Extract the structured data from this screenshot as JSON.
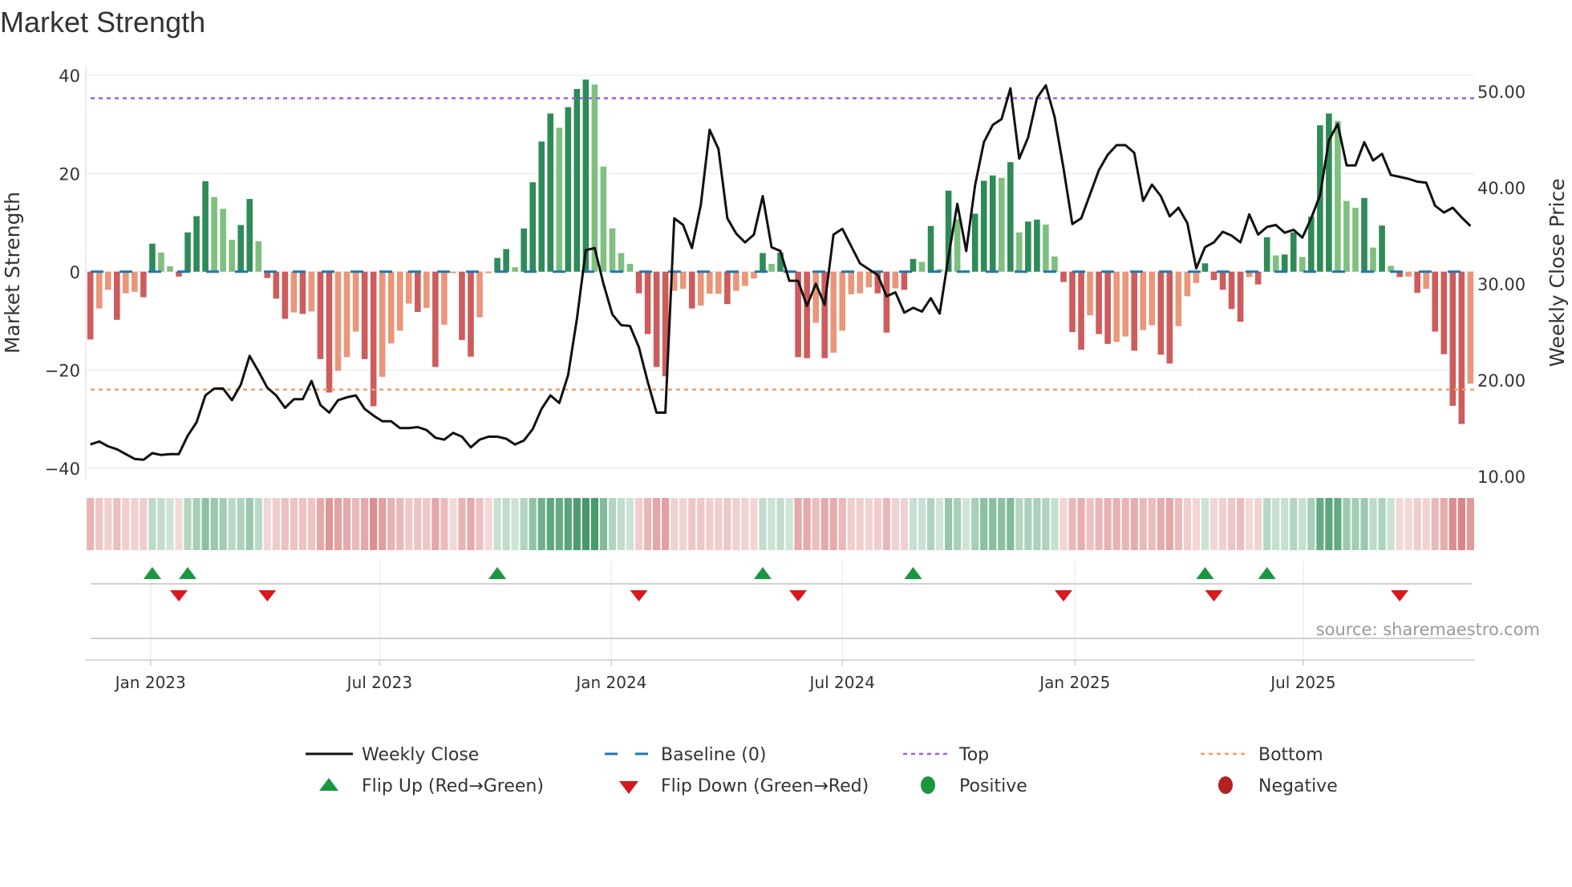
{
  "title": "Market Strength",
  "source": "source: sharemaestro.com",
  "colors": {
    "pos_strong": "#2e8b57",
    "pos_weak": "#7fbf7f",
    "neg_strong": "#cd5c5c",
    "neg_weak": "#e9967a",
    "baseline": "#1f77b4",
    "top": "#9b5de5",
    "bottom": "#f0a060",
    "close": "#111111",
    "flip_up": "#1a9641",
    "flip_down": "#d7191c",
    "positive": "#1a9641",
    "negative": "#b22222"
  },
  "chart_data": {
    "type": "bar+line",
    "title": "Market Strength",
    "ylabel": "Market Strength",
    "y2label": "Weekly Close Price",
    "ylim": [
      -42,
      42
    ],
    "y2lim": [
      9,
      51
    ],
    "yticks": [
      {
        "v": 40,
        "label": "40"
      },
      {
        "v": 20,
        "label": "20"
      },
      {
        "v": 0,
        "label": "0"
      },
      {
        "v": -20,
        "label": "−20"
      },
      {
        "v": -40,
        "label": "−40"
      }
    ],
    "y2ticks": [
      {
        "v": 50,
        "label": "50.00"
      },
      {
        "v": 40,
        "label": "40.00"
      },
      {
        "v": 30,
        "label": "30.00"
      },
      {
        "v": 20,
        "label": "20.00"
      },
      {
        "v": 10,
        "label": "10.00"
      }
    ],
    "xticks": [
      {
        "week": 6.8,
        "label": "Jan 2023"
      },
      {
        "week": 32.7,
        "label": "Jul 2023"
      },
      {
        "week": 58.9,
        "label": "Jan 2024"
      },
      {
        "week": 85.0,
        "label": "Jul 2024"
      },
      {
        "week": 111.3,
        "label": "Jan 2025"
      },
      {
        "week": 137.1,
        "label": "Jul 2025"
      }
    ],
    "top_level": 35.3,
    "bottom_level": -24,
    "strength": [
      -13.8,
      -7.5,
      -3.7,
      -9.8,
      -4.4,
      -4.1,
      -5.2,
      5.7,
      3.9,
      1.1,
      -1.0,
      8.0,
      11.3,
      18.4,
      15.2,
      12.8,
      6.5,
      9.5,
      14.8,
      6.2,
      -1.3,
      -5.5,
      -9.6,
      -8.3,
      -8.6,
      -8.1,
      -17.8,
      -24.6,
      -20.2,
      -17.4,
      -12.2,
      -17.8,
      -27.4,
      -21.4,
      -14.6,
      -12.0,
      -6.5,
      -8.2,
      -7.4,
      -19.4,
      -10.8,
      -0.3,
      -13.9,
      -17.3,
      -9.3,
      -0.3,
      2.8,
      4.6,
      0.9,
      8.8,
      18.2,
      26.5,
      32.2,
      29.3,
      33.5,
      37.2,
      39.1,
      38.1,
      21.4,
      8.8,
      3.8,
      1.6,
      -4.4,
      -12.7,
      -19.4,
      -21.3,
      -3.9,
      -3.5,
      -7.5,
      -6.9,
      -4.5,
      -4.5,
      -6.6,
      -3.9,
      -2.9,
      -1.4,
      3.8,
      1.6,
      3.9,
      0.3,
      -17.4,
      -17.6,
      -10.4,
      -17.6,
      -16.5,
      -12.0,
      -4.6,
      -4.4,
      -3.2,
      -4.4,
      -12.4,
      -3.4,
      -3.7,
      2.6,
      2.0,
      9.3,
      0.5,
      16.5,
      10.7,
      0.3,
      11.8,
      18.5,
      19.6,
      19.1,
      22.3,
      8.0,
      10.2,
      10.6,
      9.6,
      3.1,
      -2.1,
      -12.3,
      -15.9,
      -8.9,
      -12.7,
      -14.7,
      -14.3,
      -13.2,
      -16.1,
      -11.9,
      -10.9,
      -16.9,
      -18.7,
      -11.1,
      -5.0,
      -2.3,
      1.7,
      -1.7,
      -3.7,
      -7.6,
      -10.2,
      -1.1,
      -2.6,
      7.0,
      3.3,
      3.5,
      8.0,
      3.0,
      11.2,
      29.8,
      32.2,
      30.7,
      14.4,
      13.0,
      15.0,
      4.9,
      9.4,
      1.2,
      -1.1,
      -1.0,
      -4.3,
      -3.5,
      -12.2,
      -16.8,
      -27.3,
      -31.0,
      -22.8
    ],
    "strong": [
      1,
      0,
      0,
      1,
      0,
      0,
      1,
      1,
      0,
      0,
      1,
      1,
      1,
      1,
      0,
      0,
      0,
      1,
      1,
      0,
      1,
      1,
      1,
      0,
      1,
      0,
      1,
      1,
      0,
      0,
      0,
      1,
      1,
      0,
      0,
      0,
      0,
      1,
      0,
      1,
      0,
      0,
      1,
      1,
      0,
      0,
      1,
      1,
      0,
      1,
      1,
      1,
      1,
      0,
      1,
      1,
      1,
      0,
      0,
      0,
      0,
      0,
      1,
      1,
      1,
      1,
      0,
      0,
      1,
      0,
      0,
      0,
      1,
      0,
      0,
      0,
      1,
      0,
      1,
      0,
      1,
      1,
      0,
      1,
      0,
      0,
      0,
      0,
      0,
      1,
      1,
      0,
      1,
      1,
      0,
      1,
      0,
      1,
      0,
      0,
      1,
      1,
      1,
      0,
      1,
      0,
      1,
      1,
      0,
      0,
      1,
      1,
      1,
      0,
      1,
      1,
      0,
      0,
      1,
      0,
      0,
      1,
      1,
      0,
      0,
      0,
      1,
      1,
      1,
      1,
      1,
      0,
      1,
      1,
      0,
      1,
      1,
      0,
      1,
      1,
      1,
      0,
      0,
      0,
      1,
      0,
      1,
      0,
      1,
      0,
      1,
      0,
      1,
      1,
      1,
      1,
      0
    ],
    "close": [
      13.3,
      13.6,
      13.1,
      12.8,
      12.3,
      11.8,
      11.7,
      12.4,
      12.2,
      12.3,
      12.3,
      14.2,
      15.6,
      18.4,
      19.1,
      19.1,
      17.9,
      19.5,
      22.5,
      20.9,
      19.2,
      18.4,
      17.1,
      18.0,
      18.0,
      19.9,
      17.4,
      16.6,
      17.9,
      18.2,
      18.4,
      17.0,
      16.3,
      15.7,
      15.7,
      15.0,
      15.0,
      15.1,
      14.8,
      14.0,
      13.8,
      14.5,
      14.1,
      13.0,
      13.8,
      14.1,
      14.1,
      13.9,
      13.3,
      13.7,
      14.9,
      17.0,
      18.4,
      17.6,
      20.5,
      26.4,
      33.5,
      33.7,
      30.0,
      26.8,
      25.7,
      25.6,
      23.4,
      19.8,
      16.6,
      16.6,
      36.8,
      36.1,
      33.7,
      38.2,
      46.0,
      44.0,
      36.8,
      35.2,
      34.3,
      35.1,
      39.1,
      33.8,
      33.4,
      30.3,
      30.3,
      27.7,
      30.0,
      27.8,
      35.1,
      35.7,
      33.9,
      32.1,
      31.5,
      30.9,
      28.7,
      29.1,
      27.0,
      27.5,
      27.1,
      28.5,
      26.9,
      32.8,
      38.3,
      33.4,
      40.2,
      44.7,
      46.5,
      47.1,
      50.3,
      43.0,
      45.2,
      49.3,
      50.6,
      47.3,
      42.0,
      36.2,
      36.8,
      39.3,
      41.8,
      43.4,
      44.4,
      44.4,
      43.6,
      38.6,
      40.3,
      39.1,
      37.0,
      37.9,
      36.3,
      31.6,
      33.8,
      34.3,
      35.4,
      35.0,
      34.3,
      37.2,
      35.1,
      35.9,
      36.1,
      35.3,
      35.6,
      34.8,
      36.8,
      39.2,
      44.9,
      46.6,
      42.3,
      42.3,
      44.7,
      42.8,
      43.5,
      41.3,
      41.1,
      40.9,
      40.6,
      40.5,
      38.1,
      37.4,
      37.9,
      36.9,
      36.0
    ],
    "flip_up_weeks": [
      7,
      11,
      46,
      76,
      93,
      126,
      133
    ],
    "flip_down_weeks": [
      10,
      20,
      62,
      80,
      110,
      127,
      148
    ],
    "legend_placement": "bottom"
  },
  "legend": {
    "weekly_close": "Weekly Close",
    "baseline": "Baseline (0)",
    "top": "Top",
    "bottom": "Bottom",
    "flip_up": "Flip Up (Red→Green)",
    "flip_down": "Flip Down (Green→Red)",
    "positive": "Positive",
    "negative": "Negative"
  }
}
